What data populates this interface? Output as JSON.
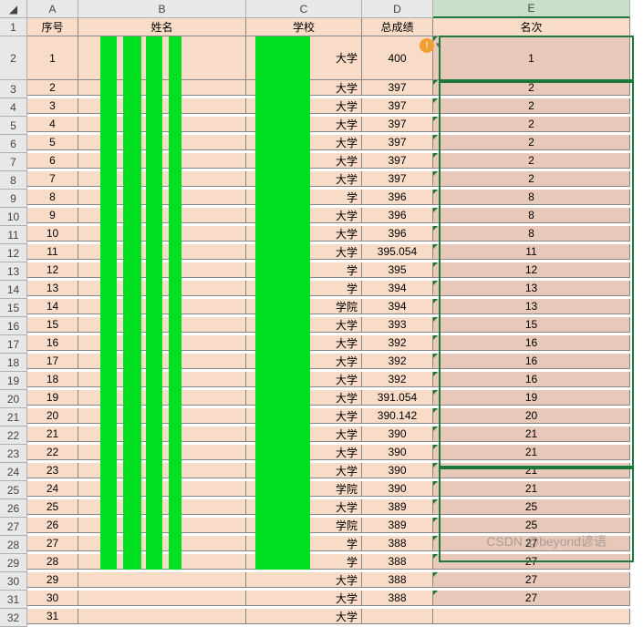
{
  "columns": [
    "A",
    "B",
    "C",
    "D",
    "E"
  ],
  "headers": {
    "A": "序号",
    "B": "姓名",
    "C": "学校",
    "D": "总成绩",
    "E": "名次"
  },
  "rows": [
    {
      "r": 2,
      "A": "1",
      "C": "大学",
      "D": "400",
      "E": "1",
      "tall": true
    },
    {
      "r": 3,
      "A": "2",
      "C": "大学",
      "D": "397",
      "E": "2"
    },
    {
      "r": 4,
      "A": "3",
      "C": "大学",
      "D": "397",
      "E": "2"
    },
    {
      "r": 5,
      "A": "4",
      "C": "大学",
      "D": "397",
      "E": "2"
    },
    {
      "r": 6,
      "A": "5",
      "C": "大学",
      "D": "397",
      "E": "2"
    },
    {
      "r": 7,
      "A": "6",
      "C": "大学",
      "D": "397",
      "E": "2"
    },
    {
      "r": 8,
      "A": "7",
      "C": "大学",
      "D": "397",
      "E": "2"
    },
    {
      "r": 9,
      "A": "8",
      "C": "学",
      "D": "396",
      "E": "8"
    },
    {
      "r": 10,
      "A": "9",
      "C": "大学",
      "D": "396",
      "E": "8"
    },
    {
      "r": 11,
      "A": "10",
      "C": "大学",
      "D": "396",
      "E": "8"
    },
    {
      "r": 12,
      "A": "11",
      "C": "大学",
      "D": "395.054",
      "E": "11"
    },
    {
      "r": 13,
      "A": "12",
      "C": "学",
      "D": "395",
      "E": "12"
    },
    {
      "r": 14,
      "A": "13",
      "C": "学",
      "D": "394",
      "E": "13"
    },
    {
      "r": 15,
      "A": "14",
      "C": "学院",
      "D": "394",
      "E": "13"
    },
    {
      "r": 16,
      "A": "15",
      "C": "大学",
      "D": "393",
      "E": "15"
    },
    {
      "r": 17,
      "A": "16",
      "C": "大学",
      "D": "392",
      "E": "16"
    },
    {
      "r": 18,
      "A": "17",
      "C": "大学",
      "D": "392",
      "E": "16"
    },
    {
      "r": 19,
      "A": "18",
      "C": "大学",
      "D": "392",
      "E": "16"
    },
    {
      "r": 20,
      "A": "19",
      "C": "大学",
      "D": "391.054",
      "E": "19"
    },
    {
      "r": 21,
      "A": "20",
      "C": "大学",
      "D": "390.142",
      "E": "20"
    },
    {
      "r": 22,
      "A": "21",
      "C": "大学",
      "D": "390",
      "E": "21"
    },
    {
      "r": 23,
      "A": "22",
      "C": "大学",
      "D": "390",
      "E": "21"
    },
    {
      "r": 24,
      "A": "23",
      "C": "大学",
      "D": "390",
      "E": "21"
    },
    {
      "r": 25,
      "A": "24",
      "C": "学院",
      "D": "390",
      "E": "21"
    },
    {
      "r": 26,
      "A": "25",
      "C": "大学",
      "D": "389",
      "E": "25"
    },
    {
      "r": 27,
      "A": "26",
      "C": "学院",
      "D": "389",
      "E": "25"
    },
    {
      "r": 28,
      "A": "27",
      "C": "学",
      "D": "388",
      "E": "27"
    },
    {
      "r": 29,
      "A": "28",
      "C": "学",
      "D": "388",
      "E": "27"
    },
    {
      "r": 30,
      "A": "29",
      "C": "大学",
      "D": "388",
      "E": "27"
    },
    {
      "r": 31,
      "A": "30",
      "C": "大学",
      "D": "388",
      "E": "27"
    },
    {
      "r": 32,
      "A": "31",
      "C": "大学",
      "D": "",
      "E": ""
    }
  ],
  "warn_icon": "!",
  "watermark": "CSDN @beyond谚语"
}
